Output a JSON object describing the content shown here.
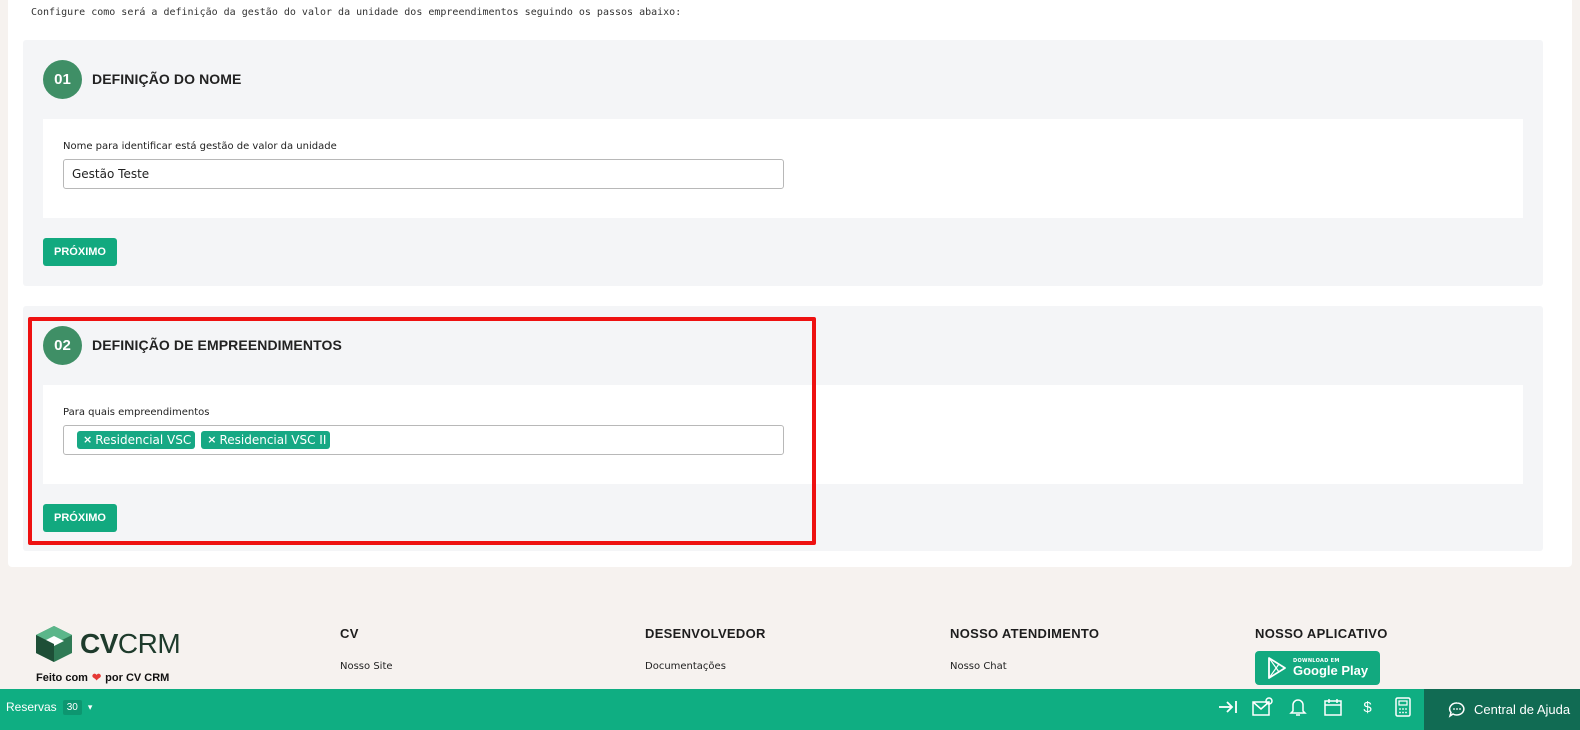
{
  "intro_text": "Configure como será a definição da gestão do valor da unidade dos empreendimentos seguindo os passos abaixo:",
  "step1": {
    "number": "01",
    "title": "DEFINIÇÃO DO NOME",
    "field_label": "Nome para identificar está gestão de valor da unidade",
    "field_value": "Gestão Teste",
    "next_label": "PRÓXIMO"
  },
  "step2": {
    "number": "02",
    "title": "DEFINIÇÃO DE EMPREENDIMENTOS",
    "field_label": "Para quais empreendimentos",
    "tags": [
      "Residencial VSC",
      "Residencial VSC II"
    ],
    "next_label": "PRÓXIMO"
  },
  "footer": {
    "logo_text_bold": "CV",
    "logo_text_rest": "CRM",
    "made_with_prefix": "Feito com",
    "made_with_suffix": "por CV CRM",
    "columns": [
      {
        "title": "CV",
        "link": "Nosso Site"
      },
      {
        "title": "DESENVOLVEDOR",
        "link": "Documentações"
      },
      {
        "title": "NOSSO ATENDIMENTO",
        "link": "Nosso Chat"
      },
      {
        "title": "NOSSO APLICATIVO"
      }
    ],
    "gplay_small": "DOWNLOAD EM",
    "gplay_big": "Google Play"
  },
  "bottom_bar": {
    "reservas_label": "Reservas",
    "reservas_count": "30",
    "icons": [
      "collapse-icon",
      "mail-settings-icon",
      "bell-icon",
      "calendar-icon",
      "dollar-icon",
      "calculator-icon"
    ],
    "help_label": "Central de Ajuda"
  },
  "colors": {
    "accent": "#12a97f",
    "step_badge": "#3f8f66",
    "highlight": "#ee1111",
    "help_bg": "#116b53"
  }
}
